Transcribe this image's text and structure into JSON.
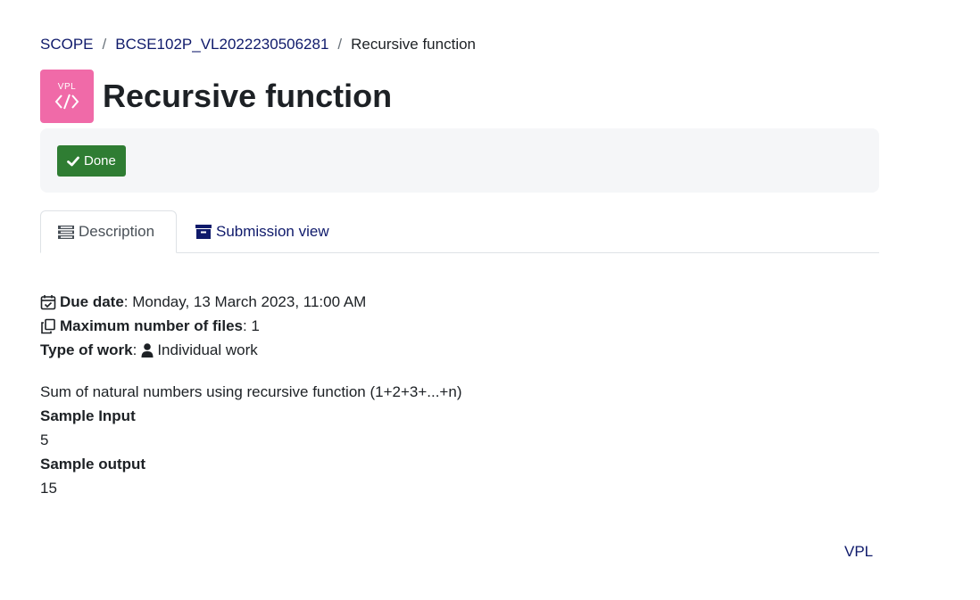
{
  "breadcrumb": {
    "items": [
      "SCOPE",
      "BCSE102P_VL2022230506281",
      "Recursive function"
    ],
    "separator": "/"
  },
  "header": {
    "icon_text": "VPL",
    "icon_name": "vpl-code-icon",
    "icon_color": "#f06aa8",
    "title": "Recursive function"
  },
  "completion": {
    "done_label": "Done",
    "done_color": "#2f7d33"
  },
  "tabs": [
    {
      "label": "Description",
      "icon": "list-icon",
      "active": true
    },
    {
      "label": "Submission view",
      "icon": "archive-icon",
      "active": false
    }
  ],
  "details": {
    "due_date_label": "Due date",
    "due_date_value": ": Monday, 13 March 2023, 11:00 AM",
    "max_files_label": "Maximum number of files",
    "max_files_value": ": 1",
    "type_of_work_label": "Type of work",
    "type_of_work_sep": ":",
    "type_of_work_value": "Individual work"
  },
  "description": {
    "text": "Sum of natural numbers using recursive function (1+2+3+...+n)",
    "sample_input_label": "Sample Input",
    "sample_input_value": "5",
    "sample_output_label": "Sample output",
    "sample_output_value": "15"
  },
  "footer": {
    "link_label": "VPL"
  }
}
